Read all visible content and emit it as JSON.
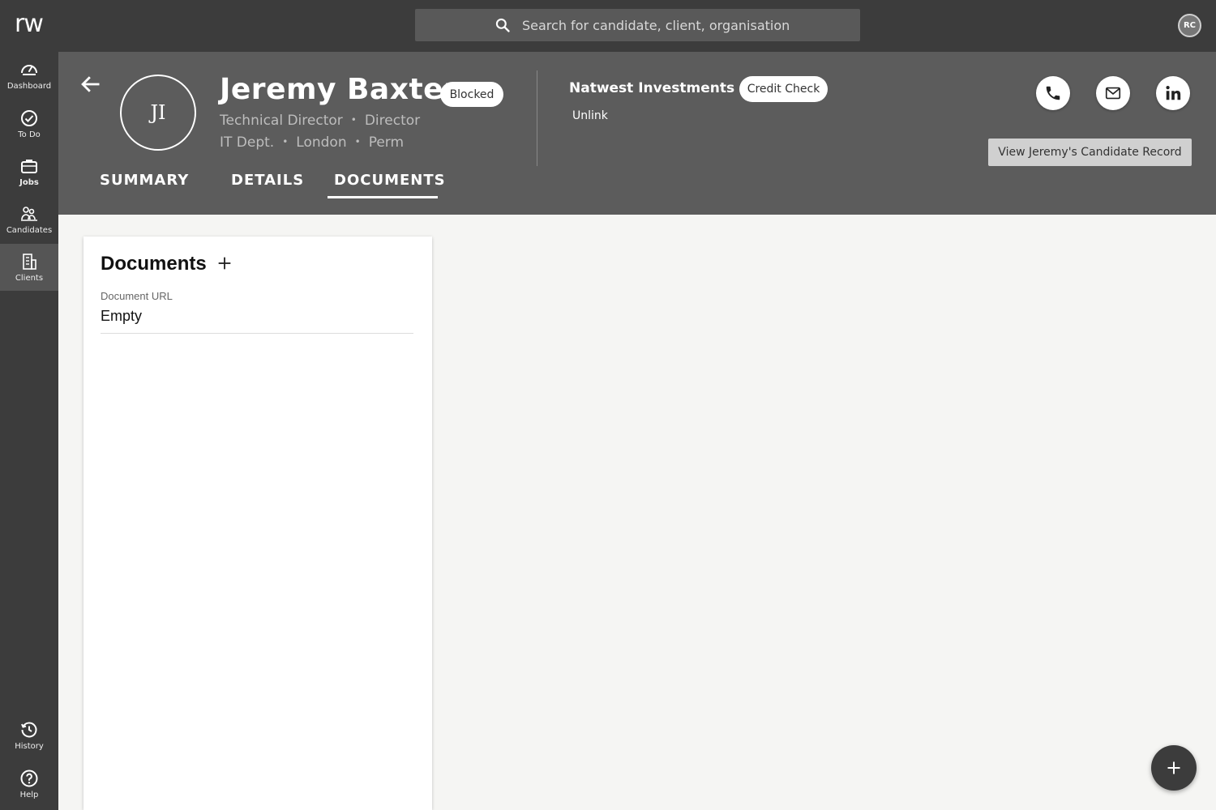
{
  "app": {
    "logo": "rw",
    "search_placeholder": "Search for candidate, client, organisation",
    "user_initials": "RC"
  },
  "sidebar": {
    "items": [
      {
        "label": "Dashboard",
        "icon": "dashboard-icon"
      },
      {
        "label": "To Do",
        "icon": "check-circle-icon"
      },
      {
        "label": "Jobs",
        "icon": "briefcase-icon"
      },
      {
        "label": "Candidates",
        "icon": "candidates-icon"
      },
      {
        "label": "Clients",
        "icon": "building-icon"
      }
    ],
    "bottom_items": [
      {
        "label": "History",
        "icon": "history-icon"
      },
      {
        "label": "Help",
        "icon": "help-icon"
      }
    ],
    "active": "Clients"
  },
  "contact": {
    "initials": "JI",
    "name": "Jeremy Baxter",
    "status_badge": "Blocked",
    "title": "Technical Director",
    "level": "Director",
    "department": "IT Dept.",
    "location": "London",
    "contract": "Perm",
    "separator": "•"
  },
  "client": {
    "name": "Natwest Investments",
    "badge": "Credit Check",
    "unlink_label": "Unlink"
  },
  "actions": {
    "view_record_label": "View Jeremy's Candidate Record",
    "icons": [
      "phone-icon",
      "email-icon",
      "linkedin-icon"
    ]
  },
  "tabs": [
    {
      "label": "SUMMARY",
      "active": false
    },
    {
      "label": "DETAILS",
      "active": false
    },
    {
      "label": "DOCUMENTS",
      "active": true
    }
  ],
  "documents_card": {
    "title": "Documents",
    "field_label": "Document URL",
    "field_value": "Empty"
  },
  "colors": {
    "topbar": "#3c3c3c",
    "header": "#5c5c5c",
    "background": "#f5f5f3"
  }
}
